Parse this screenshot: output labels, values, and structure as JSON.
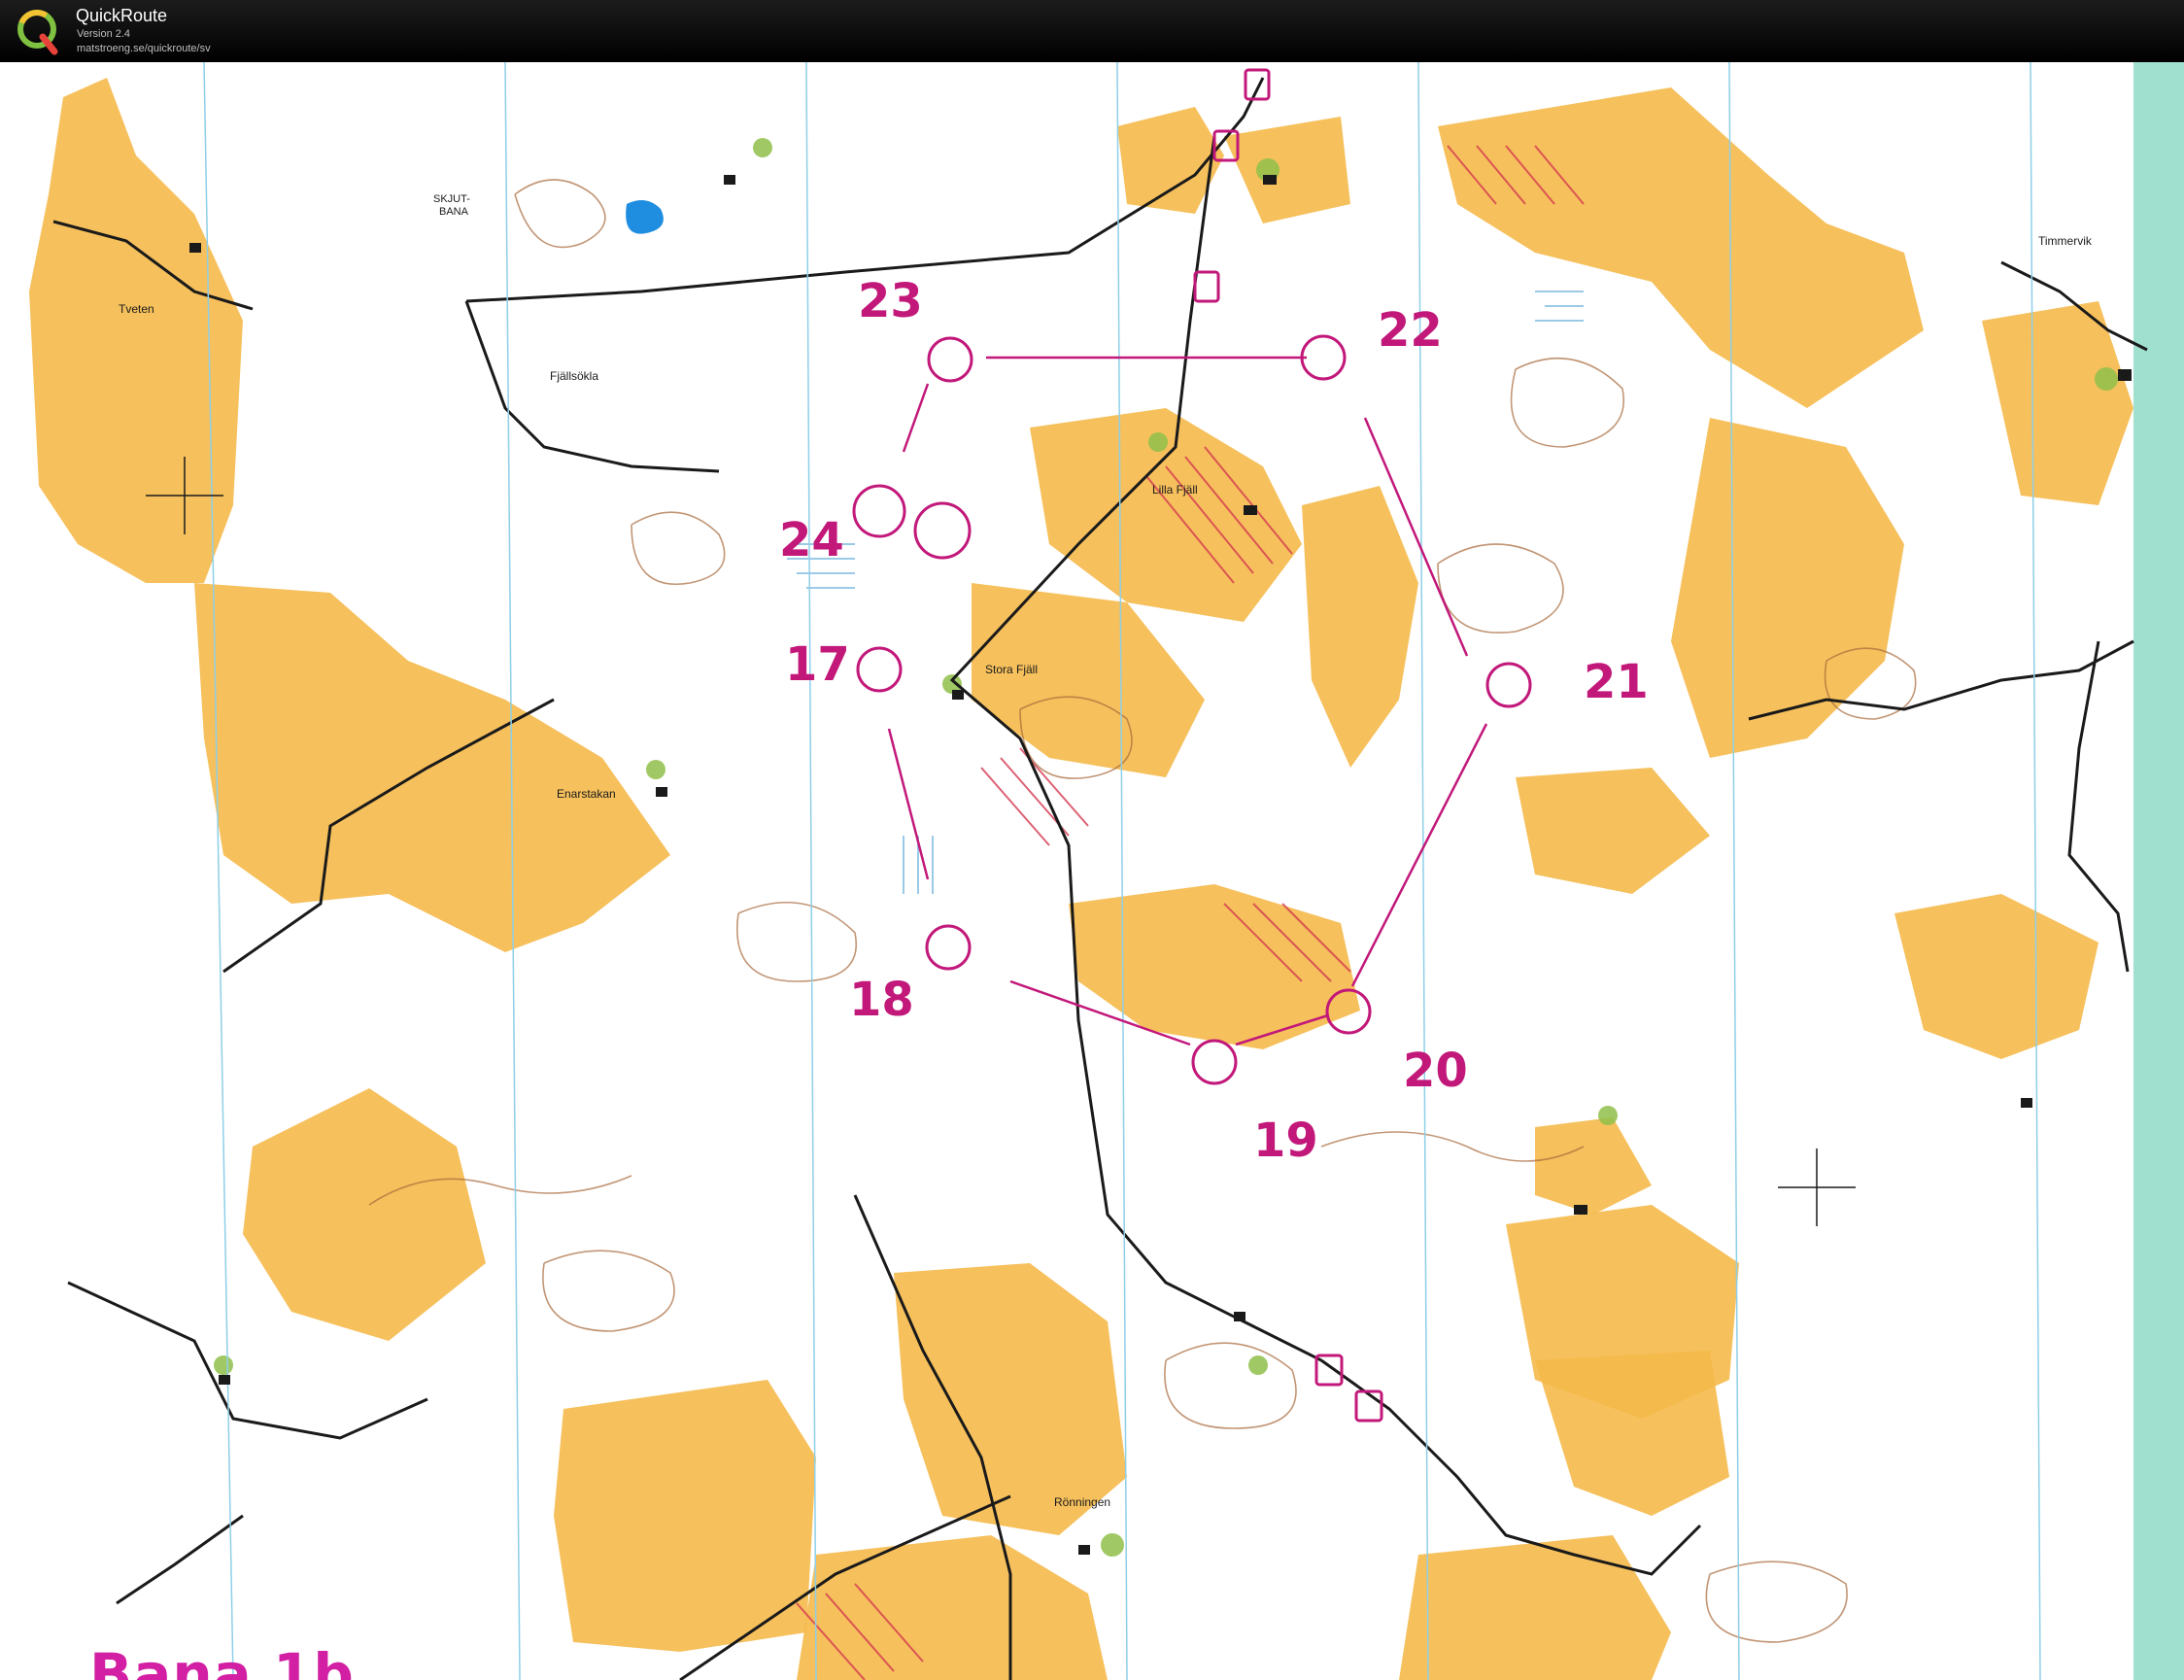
{
  "app": {
    "title": "QuickRoute",
    "version": "Version 2.4",
    "url": "matstroeng.se/quickroute/sv",
    "logo_letter": "Q",
    "logo_icon": "quickroute-q-logo-icon"
  },
  "map": {
    "place_names": {
      "tveten": "Tveten",
      "skjutbana_1": "SKJUT-",
      "skjutbana_2": "BANA",
      "fjallsokla": "Fjällsökla",
      "lilla_fjall": "Lilla Fjäll",
      "stora_fjall": "Stora Fjäll",
      "enarstakan": "Enarstakan",
      "timmervik": "Timmervik",
      "ronningen": "Rönningen"
    },
    "controls": [
      {
        "number": "17"
      },
      {
        "number": "18"
      },
      {
        "number": "19"
      },
      {
        "number": "20"
      },
      {
        "number": "21"
      },
      {
        "number": "22"
      },
      {
        "number": "23"
      },
      {
        "number": "24"
      }
    ],
    "course_title": "Bana 1b",
    "colors": {
      "field": "#f5b94a",
      "forest": "#ffffff",
      "contour": "#a86a3c",
      "course": "#c2187a",
      "road": "#1a1a1a",
      "water": "#1f8de0",
      "green": "#8fbf4a",
      "magnetic_north": "#8ecfe8",
      "marsh": "#5aa8d8",
      "edge": "#9fe0cf"
    }
  }
}
